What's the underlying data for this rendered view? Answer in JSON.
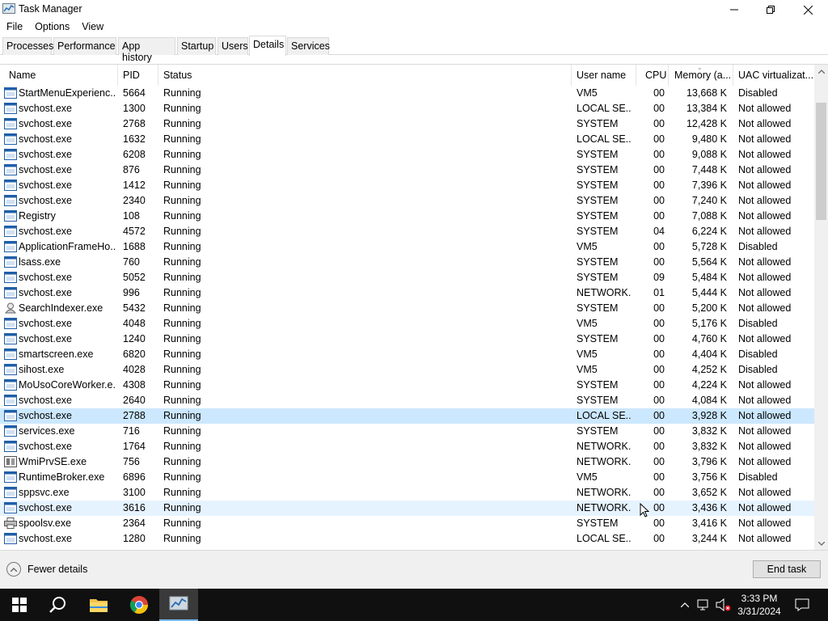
{
  "window": {
    "title": "Task Manager"
  },
  "menu": [
    "File",
    "Options",
    "View"
  ],
  "tabs": [
    "Processes",
    "Performance",
    "App history",
    "Startup",
    "Users",
    "Details",
    "Services"
  ],
  "active_tab": "Details",
  "columns": {
    "name": "Name",
    "pid": "PID",
    "status": "Status",
    "user": "User name",
    "cpu": "CPU",
    "memory": "Memory (a...",
    "uac": "UAC virtualizat..."
  },
  "rows": [
    {
      "icon": "app",
      "name": "StartMenuExperienc...",
      "pid": "5664",
      "status": "Running",
      "user": "VM5",
      "cpu": "00",
      "memory": "13,668 K",
      "uac": "Disabled"
    },
    {
      "icon": "app",
      "name": "svchost.exe",
      "pid": "1300",
      "status": "Running",
      "user": "LOCAL SE...",
      "cpu": "00",
      "memory": "13,384 K",
      "uac": "Not allowed"
    },
    {
      "icon": "app",
      "name": "svchost.exe",
      "pid": "2768",
      "status": "Running",
      "user": "SYSTEM",
      "cpu": "00",
      "memory": "12,428 K",
      "uac": "Not allowed"
    },
    {
      "icon": "app",
      "name": "svchost.exe",
      "pid": "1632",
      "status": "Running",
      "user": "LOCAL SE...",
      "cpu": "00",
      "memory": "9,480 K",
      "uac": "Not allowed"
    },
    {
      "icon": "app",
      "name": "svchost.exe",
      "pid": "6208",
      "status": "Running",
      "user": "SYSTEM",
      "cpu": "00",
      "memory": "9,088 K",
      "uac": "Not allowed"
    },
    {
      "icon": "app",
      "name": "svchost.exe",
      "pid": "876",
      "status": "Running",
      "user": "SYSTEM",
      "cpu": "00",
      "memory": "7,448 K",
      "uac": "Not allowed"
    },
    {
      "icon": "app",
      "name": "svchost.exe",
      "pid": "1412",
      "status": "Running",
      "user": "SYSTEM",
      "cpu": "00",
      "memory": "7,396 K",
      "uac": "Not allowed"
    },
    {
      "icon": "app",
      "name": "svchost.exe",
      "pid": "2340",
      "status": "Running",
      "user": "SYSTEM",
      "cpu": "00",
      "memory": "7,240 K",
      "uac": "Not allowed"
    },
    {
      "icon": "app",
      "name": "Registry",
      "pid": "108",
      "status": "Running",
      "user": "SYSTEM",
      "cpu": "00",
      "memory": "7,088 K",
      "uac": "Not allowed"
    },
    {
      "icon": "app",
      "name": "svchost.exe",
      "pid": "4572",
      "status": "Running",
      "user": "SYSTEM",
      "cpu": "04",
      "memory": "6,224 K",
      "uac": "Not allowed"
    },
    {
      "icon": "app",
      "name": "ApplicationFrameHo...",
      "pid": "1688",
      "status": "Running",
      "user": "VM5",
      "cpu": "00",
      "memory": "5,728 K",
      "uac": "Disabled"
    },
    {
      "icon": "app",
      "name": "lsass.exe",
      "pid": "760",
      "status": "Running",
      "user": "SYSTEM",
      "cpu": "00",
      "memory": "5,564 K",
      "uac": "Not allowed"
    },
    {
      "icon": "app",
      "name": "svchost.exe",
      "pid": "5052",
      "status": "Running",
      "user": "SYSTEM",
      "cpu": "09",
      "memory": "5,484 K",
      "uac": "Not allowed"
    },
    {
      "icon": "app",
      "name": "svchost.exe",
      "pid": "996",
      "status": "Running",
      "user": "NETWORK...",
      "cpu": "01",
      "memory": "5,444 K",
      "uac": "Not allowed"
    },
    {
      "icon": "search",
      "name": "SearchIndexer.exe",
      "pid": "5432",
      "status": "Running",
      "user": "SYSTEM",
      "cpu": "00",
      "memory": "5,200 K",
      "uac": "Not allowed"
    },
    {
      "icon": "app",
      "name": "svchost.exe",
      "pid": "4048",
      "status": "Running",
      "user": "VM5",
      "cpu": "00",
      "memory": "5,176 K",
      "uac": "Disabled"
    },
    {
      "icon": "app",
      "name": "svchost.exe",
      "pid": "1240",
      "status": "Running",
      "user": "SYSTEM",
      "cpu": "00",
      "memory": "4,760 K",
      "uac": "Not allowed"
    },
    {
      "icon": "app",
      "name": "smartscreen.exe",
      "pid": "6820",
      "status": "Running",
      "user": "VM5",
      "cpu": "00",
      "memory": "4,404 K",
      "uac": "Disabled"
    },
    {
      "icon": "app",
      "name": "sihost.exe",
      "pid": "4028",
      "status": "Running",
      "user": "VM5",
      "cpu": "00",
      "memory": "4,252 K",
      "uac": "Disabled"
    },
    {
      "icon": "app",
      "name": "MoUsoCoreWorker.e...",
      "pid": "4308",
      "status": "Running",
      "user": "SYSTEM",
      "cpu": "00",
      "memory": "4,224 K",
      "uac": "Not allowed"
    },
    {
      "icon": "app",
      "name": "svchost.exe",
      "pid": "2640",
      "status": "Running",
      "user": "SYSTEM",
      "cpu": "00",
      "memory": "4,084 K",
      "uac": "Not allowed"
    },
    {
      "icon": "app",
      "name": "svchost.exe",
      "pid": "2788",
      "status": "Running",
      "user": "LOCAL SE...",
      "cpu": "00",
      "memory": "3,928 K",
      "uac": "Not allowed",
      "selected": true
    },
    {
      "icon": "app",
      "name": "services.exe",
      "pid": "716",
      "status": "Running",
      "user": "SYSTEM",
      "cpu": "00",
      "memory": "3,832 K",
      "uac": "Not allowed"
    },
    {
      "icon": "app",
      "name": "svchost.exe",
      "pid": "1764",
      "status": "Running",
      "user": "NETWORK...",
      "cpu": "00",
      "memory": "3,832 K",
      "uac": "Not allowed"
    },
    {
      "icon": "wmi",
      "name": "WmiPrvSE.exe",
      "pid": "756",
      "status": "Running",
      "user": "NETWORK...",
      "cpu": "00",
      "memory": "3,796 K",
      "uac": "Not allowed"
    },
    {
      "icon": "app",
      "name": "RuntimeBroker.exe",
      "pid": "6896",
      "status": "Running",
      "user": "VM5",
      "cpu": "00",
      "memory": "3,756 K",
      "uac": "Disabled"
    },
    {
      "icon": "app",
      "name": "sppsvc.exe",
      "pid": "3100",
      "status": "Running",
      "user": "NETWORK...",
      "cpu": "00",
      "memory": "3,652 K",
      "uac": "Not allowed"
    },
    {
      "icon": "app",
      "name": "svchost.exe",
      "pid": "3616",
      "status": "Running",
      "user": "NETWORK...",
      "cpu": "00",
      "memory": "3,436 K",
      "uac": "Not allowed",
      "hover": true
    },
    {
      "icon": "printer",
      "name": "spoolsv.exe",
      "pid": "2364",
      "status": "Running",
      "user": "SYSTEM",
      "cpu": "00",
      "memory": "3,416 K",
      "uac": "Not allowed"
    },
    {
      "icon": "app",
      "name": "svchost.exe",
      "pid": "1280",
      "status": "Running",
      "user": "LOCAL SE...",
      "cpu": "00",
      "memory": "3,244 K",
      "uac": "Not allowed"
    }
  ],
  "footer": {
    "fewer_details": "Fewer details",
    "end_task": "End task"
  },
  "taskbar": {
    "time": "3:33 PM",
    "date": "3/31/2024"
  },
  "colors": {
    "selected_row": "#cce8ff",
    "hover_row": "#e5f3ff",
    "taskbar": "#101010",
    "accent": "#76b9ed"
  }
}
